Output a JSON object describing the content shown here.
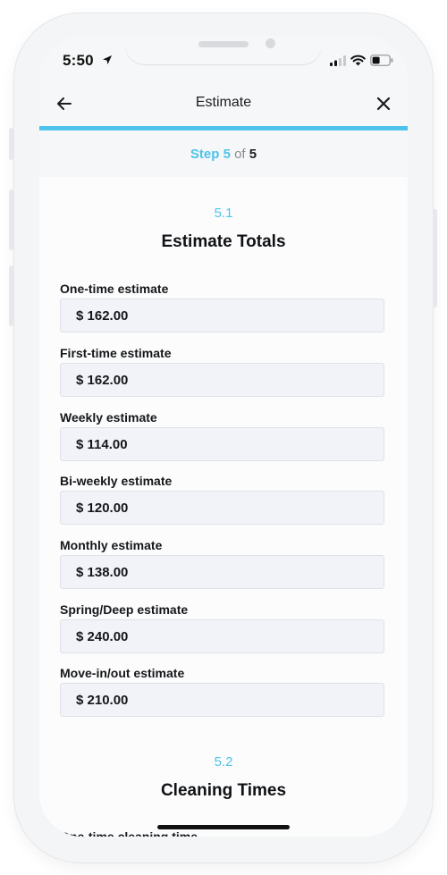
{
  "status": {
    "time": "5:50"
  },
  "header": {
    "title": "Estimate"
  },
  "step": {
    "label": "Step",
    "current": "5",
    "of": "of",
    "total": "5"
  },
  "sections": [
    {
      "number": "5.1",
      "title": "Estimate Totals",
      "fields": [
        {
          "label": "One-time estimate",
          "value": "$ 162.00"
        },
        {
          "label": "First-time estimate",
          "value": "$ 162.00"
        },
        {
          "label": "Weekly estimate",
          "value": "$ 114.00"
        },
        {
          "label": "Bi-weekly estimate",
          "value": "$ 120.00"
        },
        {
          "label": "Monthly estimate",
          "value": "$ 138.00"
        },
        {
          "label": "Spring/Deep estimate",
          "value": "$ 240.00"
        },
        {
          "label": "Move-in/out estimate",
          "value": "$ 210.00"
        }
      ]
    },
    {
      "number": "5.2",
      "title": "Cleaning Times",
      "fields": [
        {
          "label": "One-time cleaning time"
        }
      ]
    }
  ],
  "colors": {
    "accent": "#4fc3ec",
    "field_bg": "#f2f3f8",
    "text": "#16171b"
  }
}
